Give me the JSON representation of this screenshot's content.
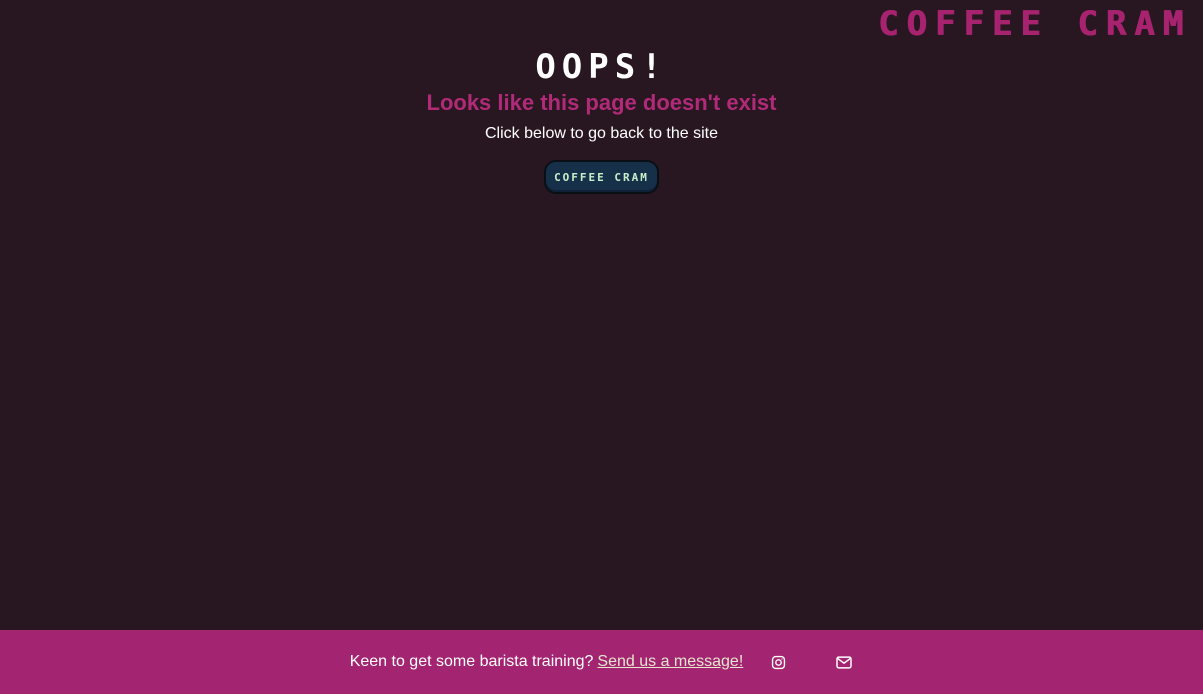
{
  "header": {
    "brand": "COFFEE CRAM"
  },
  "main": {
    "heading": "OOPS!",
    "subtitle": "Looks like this page doesn't exist",
    "helper_text": "Click below to go back to the site",
    "home_button_label": "COFFEE CRAM"
  },
  "footer": {
    "text": "Keen to get some barista training?",
    "link_text": "Send us a message!",
    "icons": [
      "instagram-icon",
      "mail-icon"
    ]
  },
  "colors": {
    "background": "#281721",
    "accent": "#a7236f",
    "footer_bg": "#a32470",
    "button_bg": "#17304a",
    "button_text": "#c6f0c8"
  }
}
